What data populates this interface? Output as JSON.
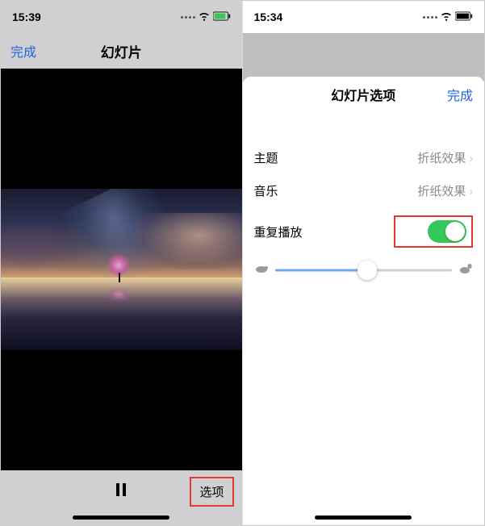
{
  "left": {
    "status": {
      "time": "15:39"
    },
    "nav": {
      "done": "完成",
      "title": "幻灯片"
    },
    "bottom": {
      "options": "选项"
    }
  },
  "right": {
    "status": {
      "time": "15:34"
    },
    "sheet": {
      "title": "幻灯片选项",
      "done": "完成"
    },
    "rows": {
      "theme": {
        "label": "主题",
        "value": "折纸效果"
      },
      "music": {
        "label": "音乐",
        "value": "折纸效果"
      },
      "repeat": {
        "label": "重复播放",
        "on": true
      }
    },
    "slider": {
      "value": 0.52
    }
  }
}
